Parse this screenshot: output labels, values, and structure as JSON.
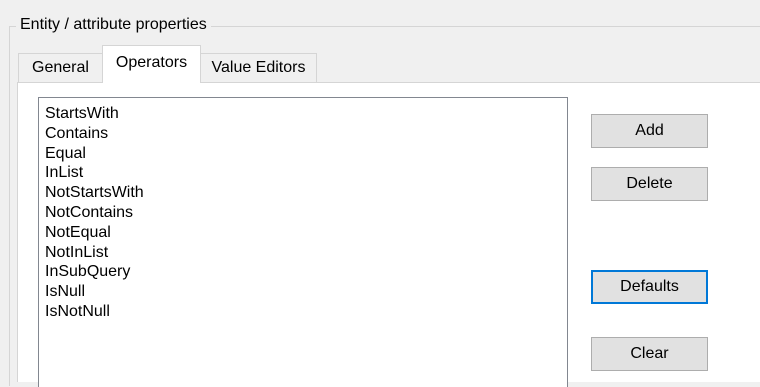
{
  "group": {
    "title": "Entity / attribute properties"
  },
  "tabs": [
    {
      "label": "General",
      "active": false
    },
    {
      "label": "Operators",
      "active": true
    },
    {
      "label": "Value Editors",
      "active": false
    }
  ],
  "operators_list": {
    "items": [
      "StartsWith",
      "Contains",
      "Equal",
      "InList",
      "NotStartsWith",
      "NotContains",
      "NotEqual",
      "NotInList",
      "InSubQuery",
      "IsNull",
      "IsNotNull"
    ]
  },
  "buttons": {
    "add": "Add",
    "delete": "Delete",
    "defaults": "Defaults",
    "clear": "Clear"
  },
  "colors": {
    "window_bg": "#f0f0f0",
    "panel_bg": "#ffffff",
    "focus_border": "#0078d7",
    "button_bg": "#e1e1e1"
  }
}
